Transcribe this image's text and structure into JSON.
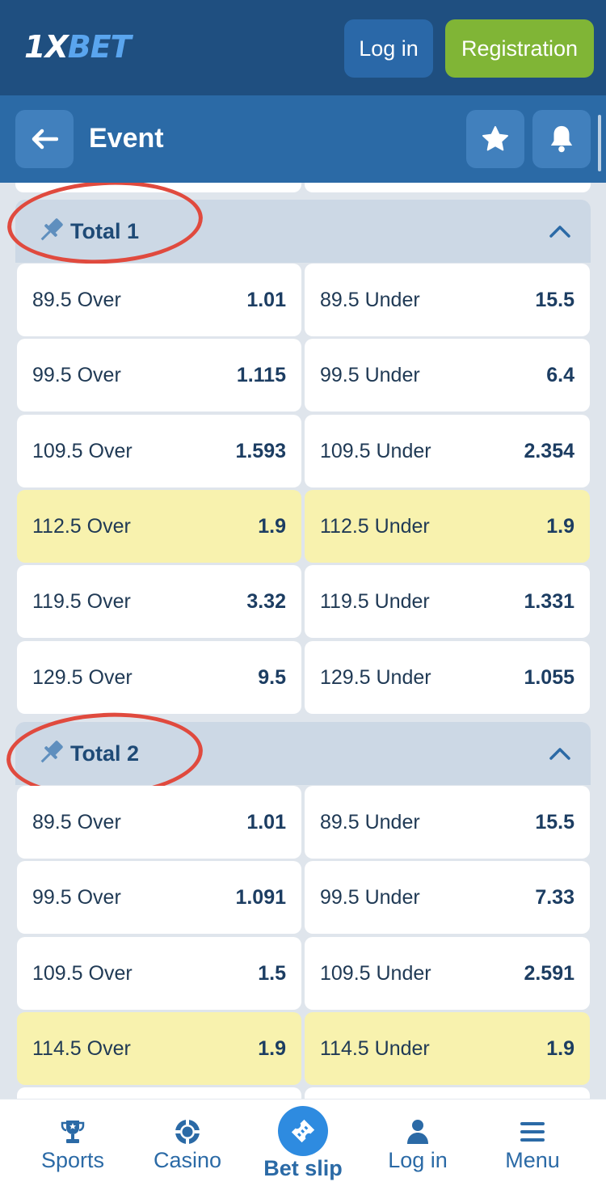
{
  "header": {
    "logo": {
      "one": "1X",
      "bet": "BET"
    },
    "login_label": "Log in",
    "registration_label": "Registration"
  },
  "event_bar": {
    "title": "Event",
    "icons": [
      "back-arrow-icon",
      "star-icon",
      "bell-icon"
    ]
  },
  "groups": [
    {
      "title": "Total 1",
      "rows": [
        {
          "over": {
            "label": "89.5 Over",
            "odd": "1.01"
          },
          "under": {
            "label": "89.5 Under",
            "odd": "15.5"
          },
          "highlighted": false
        },
        {
          "over": {
            "label": "99.5 Over",
            "odd": "1.115"
          },
          "under": {
            "label": "99.5 Under",
            "odd": "6.4"
          },
          "highlighted": false
        },
        {
          "over": {
            "label": "109.5 Over",
            "odd": "1.593"
          },
          "under": {
            "label": "109.5 Under",
            "odd": "2.354"
          },
          "highlighted": false
        },
        {
          "over": {
            "label": "112.5 Over",
            "odd": "1.9"
          },
          "under": {
            "label": "112.5 Under",
            "odd": "1.9"
          },
          "highlighted": true
        },
        {
          "over": {
            "label": "119.5 Over",
            "odd": "3.32"
          },
          "under": {
            "label": "119.5 Under",
            "odd": "1.331"
          },
          "highlighted": false
        },
        {
          "over": {
            "label": "129.5 Over",
            "odd": "9.5"
          },
          "under": {
            "label": "129.5 Under",
            "odd": "1.055"
          },
          "highlighted": false
        }
      ]
    },
    {
      "title": "Total 2",
      "rows": [
        {
          "over": {
            "label": "89.5 Over",
            "odd": "1.01"
          },
          "under": {
            "label": "89.5 Under",
            "odd": "15.5"
          },
          "highlighted": false
        },
        {
          "over": {
            "label": "99.5 Over",
            "odd": "1.091"
          },
          "under": {
            "label": "99.5 Under",
            "odd": "7.33"
          },
          "highlighted": false
        },
        {
          "over": {
            "label": "109.5 Over",
            "odd": "1.5"
          },
          "under": {
            "label": "109.5 Under",
            "odd": "2.591"
          },
          "highlighted": false
        },
        {
          "over": {
            "label": "114.5 Over",
            "odd": "1.9"
          },
          "under": {
            "label": "114.5 Under",
            "odd": "1.9"
          },
          "highlighted": true
        }
      ]
    }
  ],
  "bottom_nav": [
    {
      "label": "Sports",
      "icon": "trophy-icon"
    },
    {
      "label": "Casino",
      "icon": "casino-chip-icon"
    },
    {
      "label": "Bet slip",
      "icon": "ticket-icon"
    },
    {
      "label": "Log in",
      "icon": "user-icon"
    },
    {
      "label": "Menu",
      "icon": "hamburger-icon"
    }
  ],
  "colors": {
    "header_dark": "#1f4f80",
    "header_blue": "#2b6aa6",
    "registration_green": "#80b536",
    "highlight_yellow": "#f8f2ae",
    "annotation_red": "#e04a3e"
  }
}
